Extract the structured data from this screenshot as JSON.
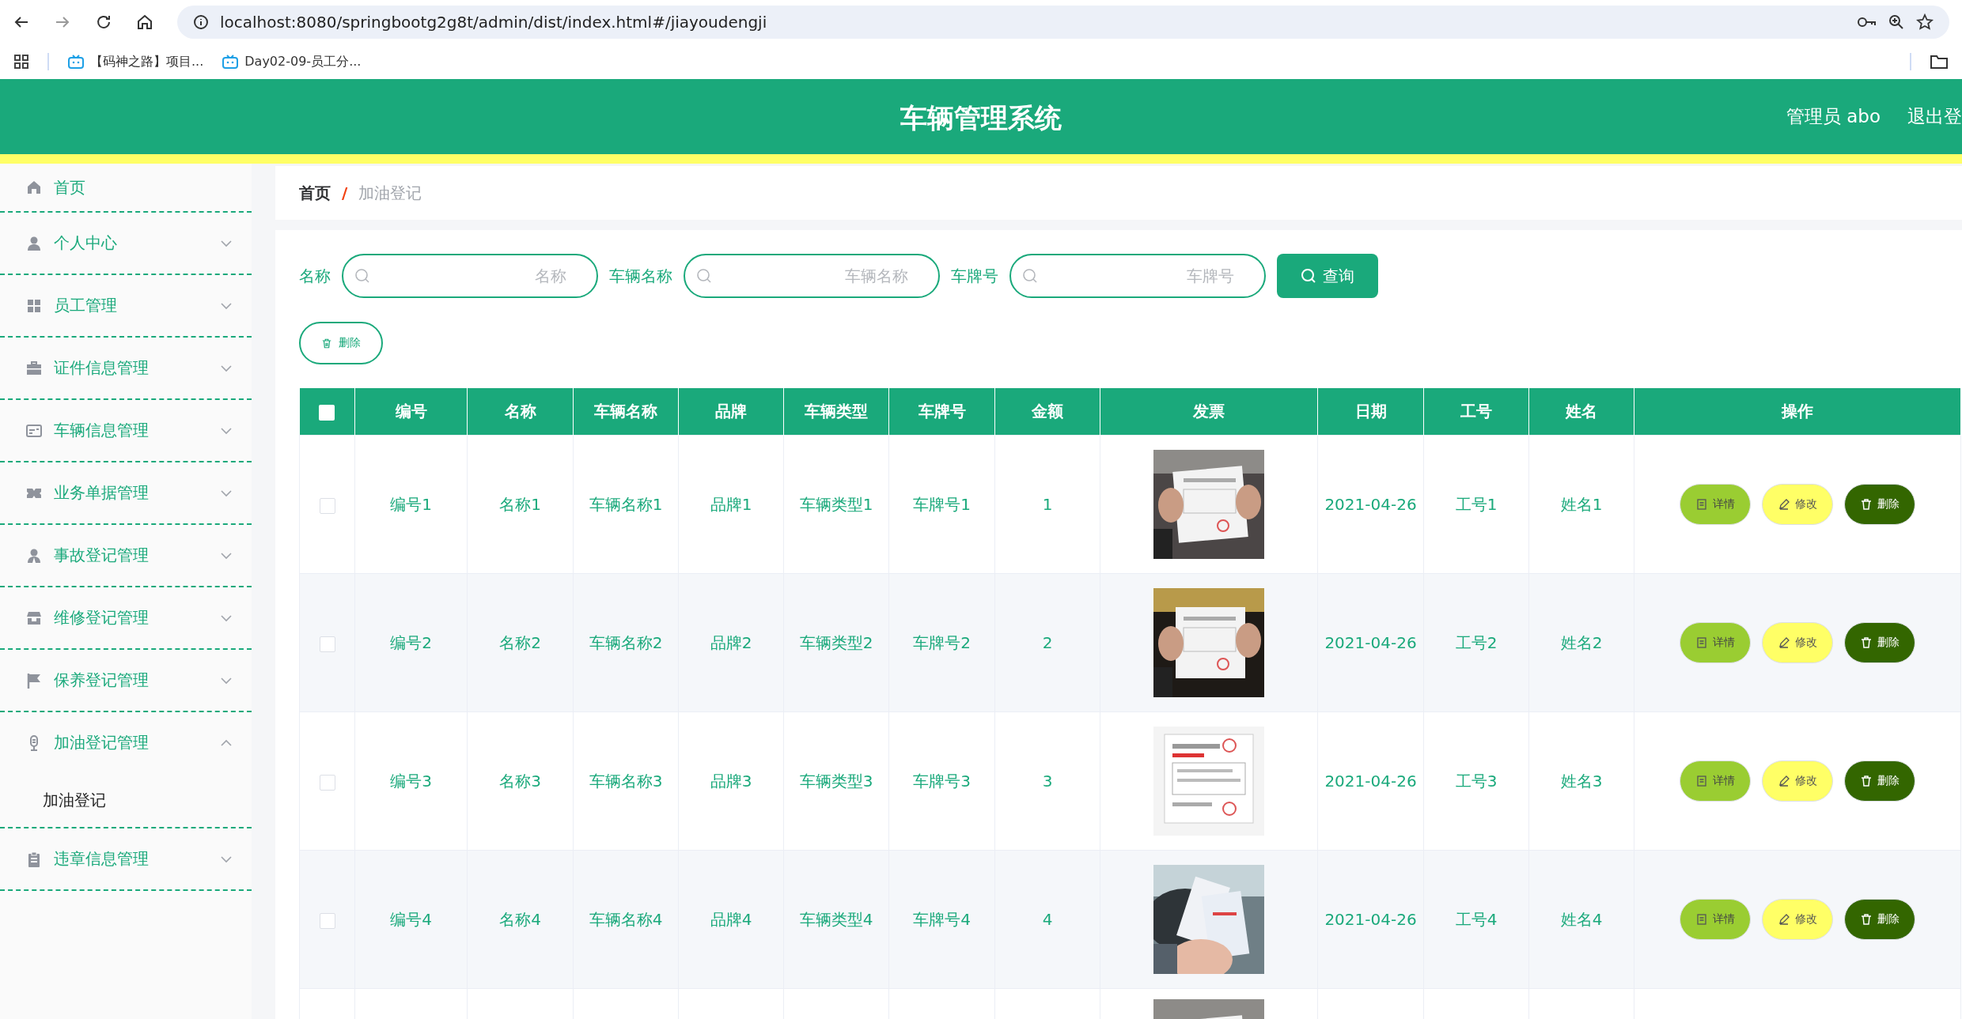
{
  "browser": {
    "url": "localhost:8080/springbootg2g8t/admin/dist/index.html#/jiayoudengji",
    "bookmarks": [
      "【码神之路】项目...",
      "Day02-09-员工分..."
    ]
  },
  "header": {
    "title": "车辆管理系统",
    "user": "管理员 abo",
    "logout": "退出登"
  },
  "sidebar": {
    "items": [
      {
        "label": "首页"
      },
      {
        "label": "个人中心",
        "expanded": false
      },
      {
        "label": "员工管理",
        "expanded": false
      },
      {
        "label": "证件信息管理",
        "expanded": false
      },
      {
        "label": "车辆信息管理",
        "expanded": false
      },
      {
        "label": "业务单据管理",
        "expanded": false
      },
      {
        "label": "事故登记管理",
        "expanded": false
      },
      {
        "label": "维修登记管理",
        "expanded": false
      },
      {
        "label": "保养登记管理",
        "expanded": false
      },
      {
        "label": "加油登记管理",
        "expanded": true,
        "children": [
          {
            "label": "加油登记"
          }
        ]
      },
      {
        "label": "违章信息管理",
        "expanded": false
      }
    ]
  },
  "breadcrumb": {
    "home": "首页",
    "separator": "/",
    "current": "加油登记"
  },
  "search": {
    "fields": [
      {
        "label": "名称",
        "placeholder": "名称"
      },
      {
        "label": "车辆名称",
        "placeholder": "车辆名称"
      },
      {
        "label": "车牌号",
        "placeholder": "车牌号"
      }
    ],
    "button": "查询"
  },
  "batch_delete": "删除",
  "table": {
    "header_checked": false,
    "columns": [
      "编号",
      "名称",
      "车辆名称",
      "品牌",
      "车辆类型",
      "车牌号",
      "金额",
      "发票",
      "日期",
      "工号",
      "姓名",
      "操作"
    ],
    "rows": [
      {
        "checked": false,
        "cells": [
          "编号1",
          "名称1",
          "车辆名称1",
          "品牌1",
          "车辆类型1",
          "车牌号1",
          "1"
        ],
        "invoice": {
          "kind": "picture"
        },
        "after": [
          "2021-04-26",
          "工号1",
          "姓名1"
        ],
        "actions": [
          {
            "kind": "detail",
            "label": "详情"
          },
          {
            "kind": "edit",
            "label": "修改"
          },
          {
            "kind": "delete",
            "label": "删除"
          }
        ]
      },
      {
        "checked": false,
        "cells": [
          "编号2",
          "名称2",
          "车辆名称2",
          "品牌2",
          "车辆类型2",
          "车牌号2",
          "2"
        ],
        "invoice": {
          "kind": "picture"
        },
        "after": [
          "2021-04-26",
          "工号2",
          "姓名2"
        ],
        "actions": [
          {
            "kind": "detail",
            "label": "详情"
          },
          {
            "kind": "edit",
            "label": "修改"
          },
          {
            "kind": "delete",
            "label": "删除"
          }
        ]
      },
      {
        "checked": false,
        "cells": [
          "编号3",
          "名称3",
          "车辆名称3",
          "品牌3",
          "车辆类型3",
          "车牌号3",
          "3"
        ],
        "invoice": {
          "kind": "picture"
        },
        "after": [
          "2021-04-26",
          "工号3",
          "姓名3"
        ],
        "actions": [
          {
            "kind": "detail",
            "label": "详情"
          },
          {
            "kind": "edit",
            "label": "修改"
          },
          {
            "kind": "delete",
            "label": "删除"
          }
        ]
      },
      {
        "checked": false,
        "cells": [
          "编号4",
          "名称4",
          "车辆名称4",
          "品牌4",
          "车辆类型4",
          "车牌号4",
          "4"
        ],
        "invoice": {
          "kind": "picture"
        },
        "after": [
          "2021-04-26",
          "工号4",
          "姓名4"
        ],
        "actions": [
          {
            "kind": "detail",
            "label": "详情"
          },
          {
            "kind": "edit",
            "label": "修改"
          },
          {
            "kind": "delete",
            "label": "删除"
          }
        ]
      },
      {
        "invoice": {
          "kind": "picture"
        }
      }
    ]
  }
}
